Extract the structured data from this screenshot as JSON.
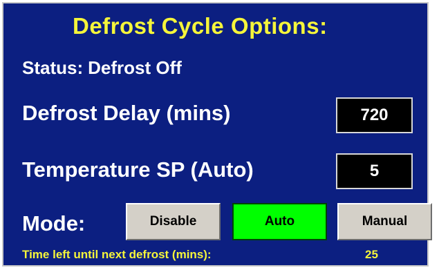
{
  "title": "Defrost Cycle Options:",
  "status": {
    "label": "Status:",
    "value": "Defrost Off"
  },
  "defrost_delay": {
    "label": "Defrost Delay (mins)",
    "value": "720"
  },
  "temperature_sp": {
    "label": "Temperature SP (Auto)",
    "value": "5"
  },
  "mode": {
    "label": "Mode:",
    "buttons": [
      {
        "label": "Disable",
        "active": false
      },
      {
        "label": "Auto",
        "active": true
      },
      {
        "label": "Manual",
        "active": false
      }
    ]
  },
  "footer": {
    "label": "Time left until next defrost (mins):",
    "value": "25"
  },
  "colors": {
    "panel_background": "#0c1f81",
    "title_text": "#f5f53a",
    "active_button": "#00ff00",
    "inactive_button": "#d4d0c8"
  }
}
